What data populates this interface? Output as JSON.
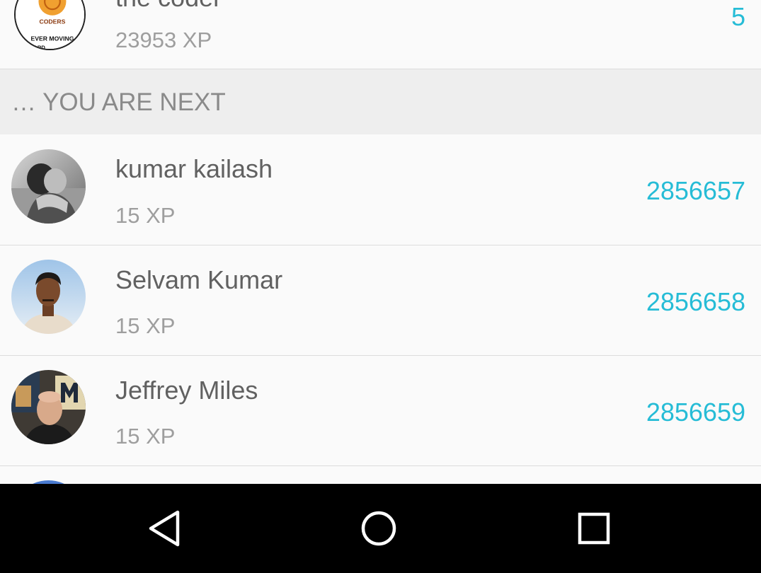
{
  "leaderboard": {
    "top_entry": {
      "name": "the coder",
      "xp": "23953 XP",
      "rank": "5",
      "avatar_icon": "coders-badge-avatar",
      "avatar_text": "CODERS",
      "avatar_tagline": "EVER MOVING",
      "avatar_tagline2": "WARD"
    },
    "section_header": "… YOU ARE NEXT",
    "entries": [
      {
        "name": "kumar kailash",
        "xp": "15 XP",
        "rank": "2856657",
        "avatar_icon": "couple-photo-avatar"
      },
      {
        "name": "Selvam Kumar",
        "xp": "15 XP",
        "rank": "2856658",
        "avatar_icon": "man-portrait-avatar"
      },
      {
        "name": "Jeffrey Miles",
        "xp": "15 XP",
        "rank": "2856659",
        "avatar_icon": "man-selfie-avatar"
      }
    ]
  },
  "navbar": {
    "back_icon": "back-triangle-icon",
    "home_icon": "home-circle-icon",
    "recents_icon": "recents-square-icon"
  },
  "colors": {
    "background": "#fafafa",
    "section_header_bg": "#eeeeee",
    "rank_accent": "#26bcd6",
    "name_text": "#616161",
    "xp_text": "#9e9e9e",
    "navbar_bg": "#000000"
  }
}
